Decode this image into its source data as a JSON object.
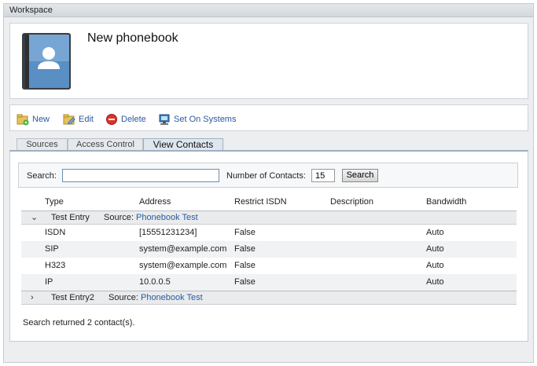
{
  "workspace": {
    "title": "Workspace"
  },
  "header": {
    "title": "New phonebook"
  },
  "toolbar": {
    "new_label": "New",
    "edit_label": "Edit",
    "delete_label": "Delete",
    "set_label": "Set On Systems"
  },
  "tabs": [
    {
      "label": "Sources",
      "active": false
    },
    {
      "label": "Access Control",
      "active": false
    },
    {
      "label": "View Contacts",
      "active": true
    }
  ],
  "search": {
    "label": "Search:",
    "value": "",
    "count_label": "Number of Contacts:",
    "count_value": "15",
    "button_label": "Search"
  },
  "table": {
    "columns": [
      "Type",
      "Address",
      "Restrict ISDN",
      "Description",
      "Bandwidth"
    ],
    "groups": [
      {
        "name": "Test Entry",
        "source_label": "Source:",
        "source": "Phonebook Test",
        "expanded": true,
        "rows": [
          {
            "type": "ISDN",
            "address": "[15551231234]",
            "restrict": "False",
            "description": "",
            "bandwidth": "Auto"
          },
          {
            "type": "SIP",
            "address": "system@example.com",
            "restrict": "False",
            "description": "",
            "bandwidth": "Auto"
          },
          {
            "type": "H323",
            "address": "system@example.com",
            "restrict": "False",
            "description": "",
            "bandwidth": "Auto"
          },
          {
            "type": "IP",
            "address": "10.0.0.5",
            "restrict": "False",
            "description": "",
            "bandwidth": "Auto"
          }
        ]
      },
      {
        "name": "Test Entry2",
        "source_label": "Source:",
        "source": "Phonebook Test",
        "expanded": false,
        "rows": []
      }
    ]
  },
  "result_text": "Search returned 2 contact(s).",
  "icons": {
    "phonebook": "phonebook-icon",
    "new": "new-icon",
    "edit": "edit-icon",
    "delete": "delete-icon",
    "set": "set-on-systems-icon"
  },
  "colors": {
    "link": "#2a5aa0",
    "book": "#5a8fc4"
  }
}
